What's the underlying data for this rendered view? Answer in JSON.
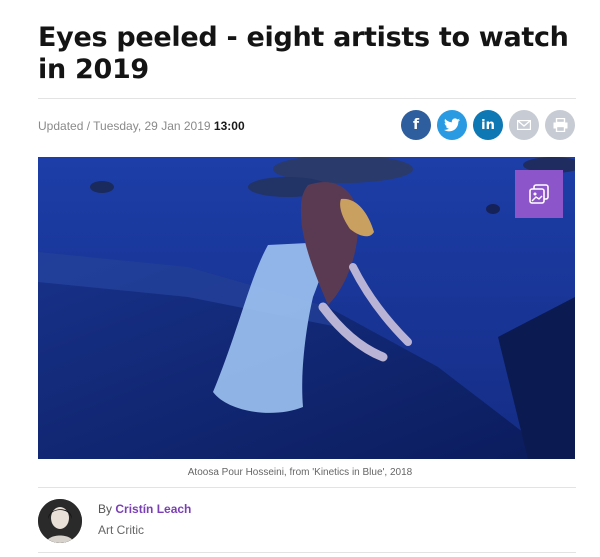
{
  "article": {
    "title": "Eyes peeled - eight artists to watch in 2019",
    "meta_prefix": "Updated / Tuesday, 29 Jan 2019",
    "meta_time": "13:00",
    "caption": "Atoosa Pour Hosseini, from 'Kinetics in Blue', 2018",
    "by_label": "By",
    "author": "Cristín Leach",
    "author_role": "Art Critic"
  },
  "share": {
    "facebook": "f",
    "twitter": "twitter-icon",
    "linkedin": "in",
    "email": "email-icon",
    "print": "print-icon"
  },
  "colors": {
    "accent": "#8c55c9",
    "facebook": "#2e5e9e",
    "twitter": "#2a9ae3",
    "linkedin": "#0e78b5",
    "neutral_icon": "#c7ccd4"
  }
}
